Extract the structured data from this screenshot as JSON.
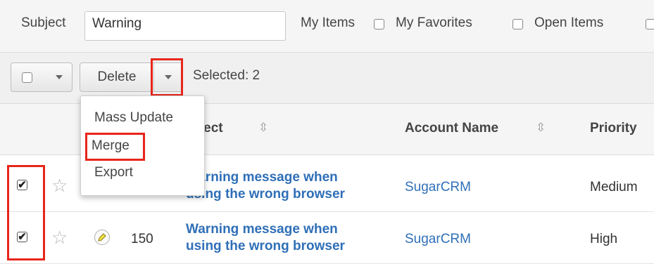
{
  "filter": {
    "subject_label": "Subject",
    "subject_value": "Warning",
    "my_items": "My Items",
    "my_favorites": "My Favorites",
    "open_items": "Open Items"
  },
  "actions": {
    "delete_label": "Delete",
    "selected_text": "Selected: 2",
    "menu": [
      "Mass Update",
      "Merge",
      "Export"
    ]
  },
  "table": {
    "headers": {
      "subject": "Subject",
      "account": "Account Name",
      "priority": "Priority"
    },
    "rows": [
      {
        "checked": true,
        "number": "",
        "subject_line1": "Warning message when",
        "subject_line2": "using the wrong browser",
        "account": "SugarCRM",
        "priority": "Medium"
      },
      {
        "checked": true,
        "number": "150",
        "subject_line1": "Warning message when",
        "subject_line2": "using the wrong browser",
        "account": "SugarCRM",
        "priority": "High"
      }
    ]
  },
  "icons": {
    "sort": "sort-arrows-icon",
    "star": "star-icon",
    "edit": "pencil-icon"
  },
  "colors": {
    "link": "#2f6fb7",
    "highlight": "#e8251a"
  },
  "check_mark": "✔"
}
